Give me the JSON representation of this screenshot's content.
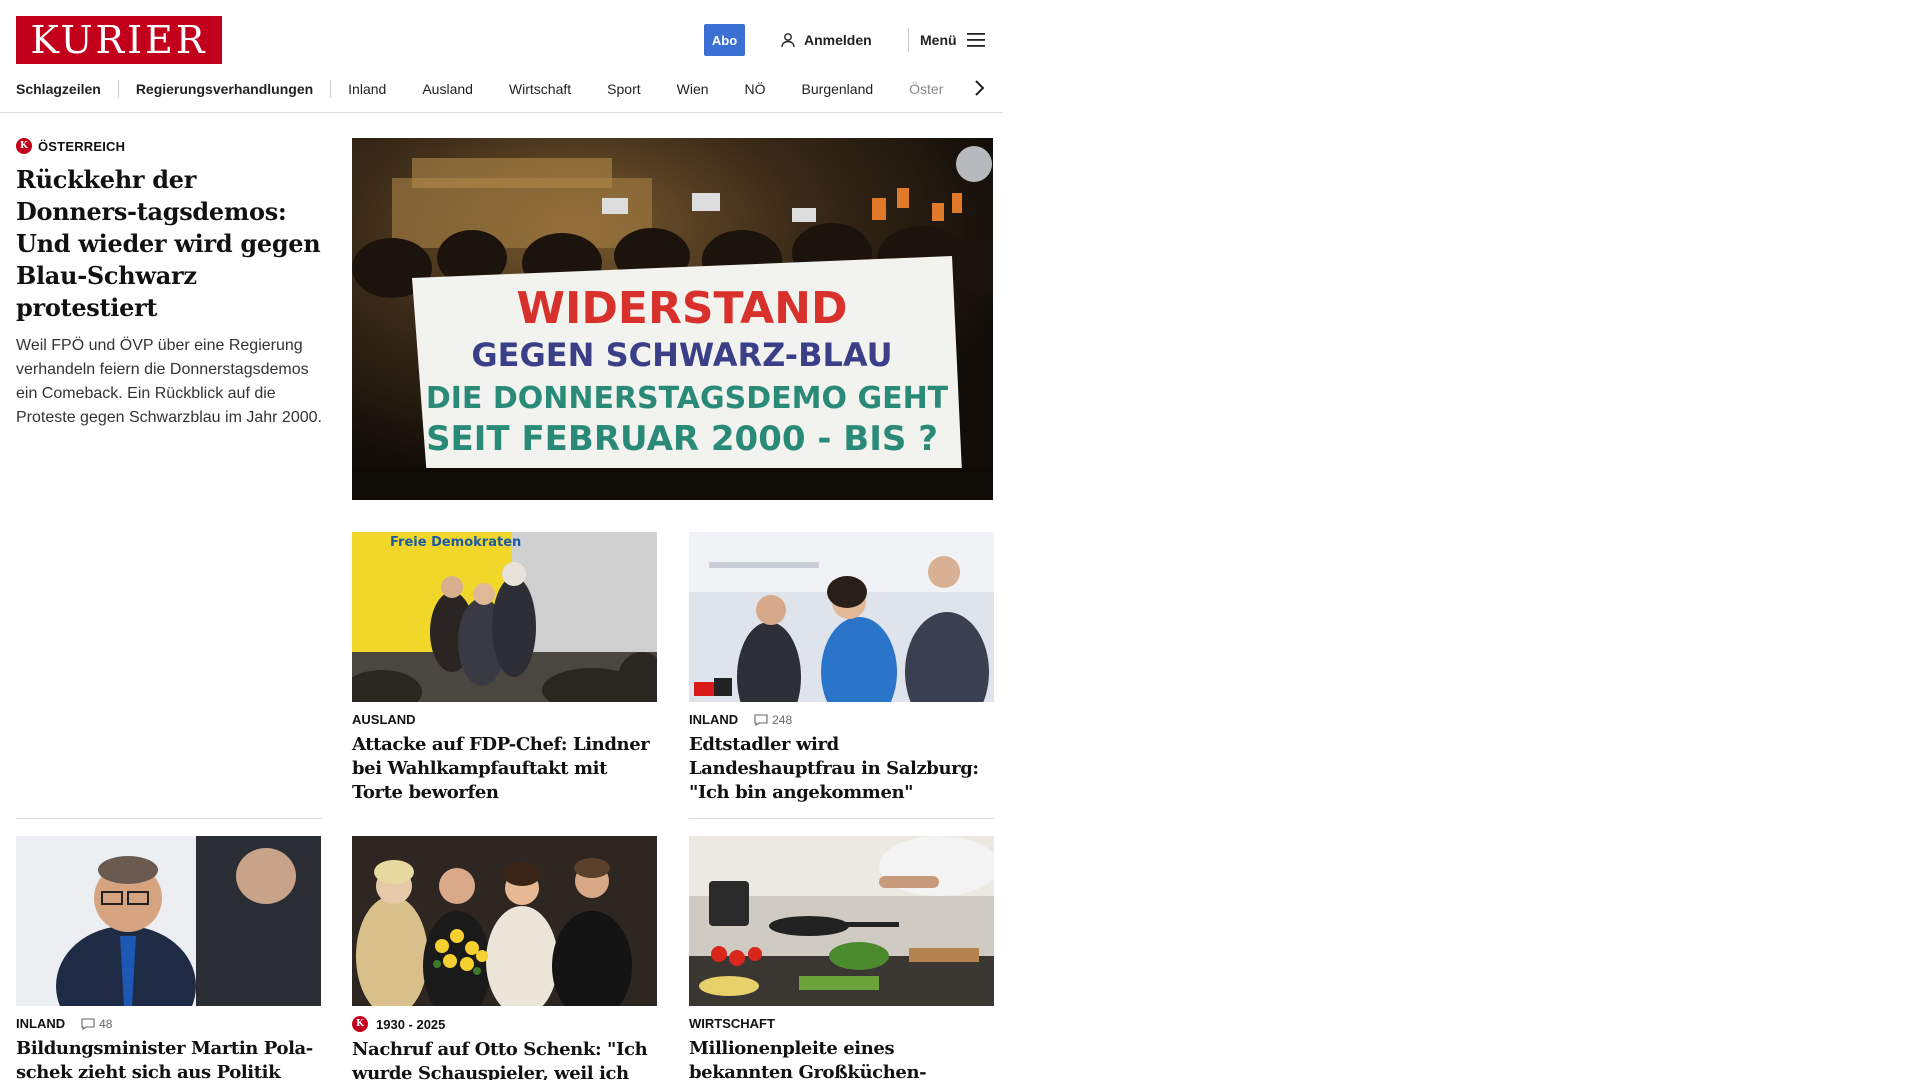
{
  "header": {
    "logo": "KURIER",
    "abo_label": "Abo",
    "login_label": "Anmelden",
    "menu_label": "Menü"
  },
  "nav": {
    "items": [
      "Schlagzeilen",
      "Regierungsverhandlungen",
      "Inland",
      "Ausland",
      "Wirtschaft",
      "Sport",
      "Wien",
      "NÖ",
      "Burgenland",
      "Öster"
    ]
  },
  "lead": {
    "kicker": "Österreich",
    "title": "Rückkehr der Donners-tagsdemos: Und wieder wird gegen Blau-Schwarz protestiert",
    "teaser": "Weil FPÖ und ÖVP über eine Regierung verhandeln feiern die Donnerstagsdemos ein Comeback. Ein Rückblick auf die Proteste gegen Schwarzblau im Jahr 2000.",
    "banner_line1": "WIDERSTAND",
    "banner_line2": "GEGEN SCHWARZ-BLAU",
    "banner_line3": "DIE DONNERSTAGSDEMO GEHT",
    "banner_line4": "SEIT FEBRUAR 2000 - BIS ?"
  },
  "cards": [
    {
      "kicker": "Ausland",
      "comments": "",
      "title": "Attacke auf FDP-Chef: Lindner bei Wahlkampfauftakt mit Torte beworfen",
      "sign": "Freie Demokraten"
    },
    {
      "kicker": "Inland",
      "comments": "248",
      "title": "Edtstadler wird Landeshauptfrau in Salzburg: \"Ich bin angekommen\""
    },
    {
      "kicker": "Inland",
      "comments": "48",
      "title": "Bildungsminister Martin Pola-schek zieht sich aus Politik zurück"
    },
    {
      "kicker": "1930 - 2025",
      "comments": "",
      "title": "Nachruf auf Otto Schenk: \"Ich wurde Schauspieler, weil ich nichts anderes kann\""
    },
    {
      "kicker": "Wirtschaft",
      "comments": "",
      "title": "Millionenpleite eines bekannten Großküchen-Herstellers"
    }
  ],
  "colors": {
    "brand": "#c3001b",
    "abo": "#3b6fd4"
  }
}
